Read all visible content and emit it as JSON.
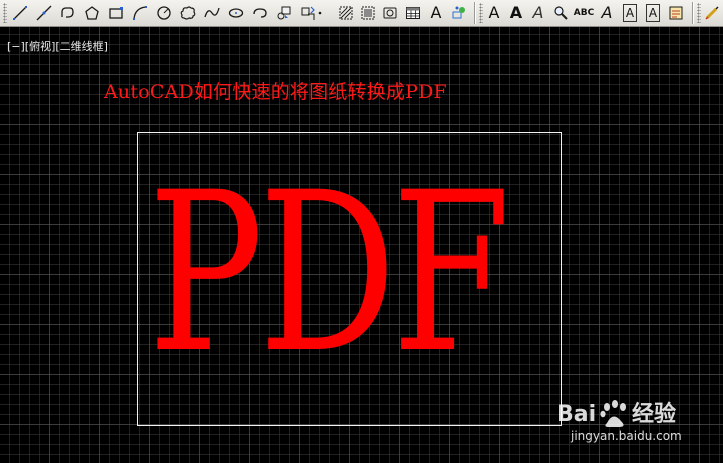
{
  "toolbar": {
    "tools": [
      {
        "name": "line-icon"
      },
      {
        "name": "construction-line-icon"
      },
      {
        "name": "polyline-icon"
      },
      {
        "name": "polygon-icon"
      },
      {
        "name": "rectangle-icon"
      },
      {
        "name": "arc-icon"
      },
      {
        "name": "circle-icon"
      },
      {
        "name": "revision-cloud-icon"
      },
      {
        "name": "spline-icon"
      },
      {
        "name": "ellipse-icon"
      },
      {
        "name": "ellipse-arc-icon"
      },
      {
        "name": "insert-block-icon"
      },
      {
        "name": "make-block-icon"
      },
      {
        "name": "point-icon"
      },
      {
        "name": "hatch-icon"
      },
      {
        "name": "gradient-icon"
      },
      {
        "name": "region-icon"
      },
      {
        "name": "table-icon"
      },
      {
        "name": "multiline-text-icon",
        "glyph": "A"
      },
      {
        "name": "add-selected-icon"
      },
      {
        "name": "text-style-icon",
        "glyph": "A"
      },
      {
        "name": "edit-text-icon",
        "glyph": "A"
      },
      {
        "name": "find-text-icon",
        "glyph": "A"
      },
      {
        "name": "spell-check-icon",
        "glyph": "ABC"
      },
      {
        "name": "text-style-manager-icon",
        "glyph": "A"
      },
      {
        "name": "scale-text-icon",
        "glyph": "A"
      },
      {
        "name": "justify-text-icon",
        "glyph": "A"
      },
      {
        "name": "convert-distance-icon"
      },
      {
        "name": "dimension-style-icon"
      }
    ]
  },
  "viewport": {
    "label": "[−][俯视][二维线框]"
  },
  "drawing": {
    "title": "AutoCAD如何快速的将图纸转换成PDF",
    "big_text": "PDF",
    "text_color": "#ff0000",
    "frame_color": "#ffffff"
  },
  "watermark": {
    "logo": "Baidu经验",
    "url": "jingyan.baidu.com"
  }
}
